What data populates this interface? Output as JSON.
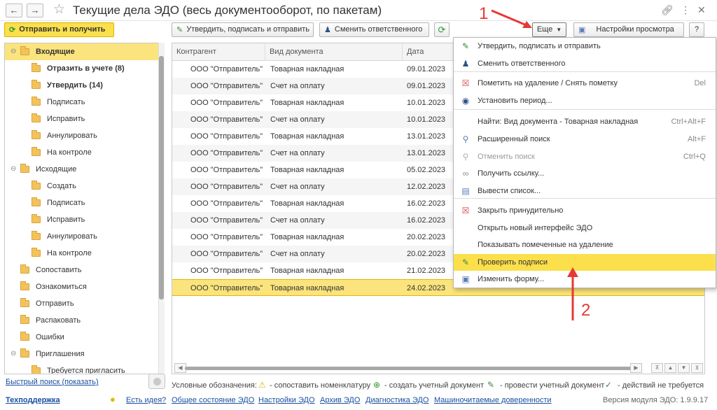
{
  "window": {
    "title": "Текущие дела ЭДО (весь документооборот, по пакетам)",
    "back_icon": "arrow-left-icon",
    "forward_icon": "arrow-right-icon",
    "favorite_icon": "star-icon",
    "link_icon": "link-icon",
    "more_icon": "more-vertical-icon",
    "close_icon": "close-icon"
  },
  "toolbar": {
    "send_receive_label": "Отправить и получить",
    "approve_label": "Утвердить, подписать и отправить",
    "change_responsible_label": "Сменить ответственного",
    "more_label": "Еще",
    "view_settings_label": "Настройки просмотра",
    "help_label": "?"
  },
  "tree": {
    "items": [
      {
        "label": "Входящие",
        "toggle": "⊖",
        "bold": true
      },
      {
        "label": "Отразить в учете (8)",
        "bold": true
      },
      {
        "label": "Утвердить (14)",
        "bold": true
      },
      {
        "label": "Подписать"
      },
      {
        "label": "Исправить"
      },
      {
        "label": "Аннулировать"
      },
      {
        "label": "На контроле"
      },
      {
        "label": "Исходящие",
        "toggle": "⊖"
      },
      {
        "label": "Создать"
      },
      {
        "label": "Подписать"
      },
      {
        "label": "Исправить"
      },
      {
        "label": "Аннулировать"
      },
      {
        "label": "На контроле"
      },
      {
        "label": "Сопоставить"
      },
      {
        "label": "Ознакомиться"
      },
      {
        "label": "Отправить"
      },
      {
        "label": "Распаковать"
      },
      {
        "label": "Ошибки"
      },
      {
        "label": "Приглашения",
        "toggle": "⊖"
      },
      {
        "label": "Требуется пригласить"
      }
    ]
  },
  "table": {
    "columns": [
      "Контрагент",
      "Вид документа",
      "Дата"
    ],
    "rows": [
      {
        "counterparty": "ООО \"Отправитель\"",
        "doc_type": "Товарная накладная",
        "date": "09.01.2023"
      },
      {
        "counterparty": "ООО \"Отправитель\"",
        "doc_type": "Счет на оплату",
        "date": "09.01.2023"
      },
      {
        "counterparty": "ООО \"Отправитель\"",
        "doc_type": "Товарная накладная",
        "date": "10.01.2023"
      },
      {
        "counterparty": "ООО \"Отправитель\"",
        "doc_type": "Счет на оплату",
        "date": "10.01.2023"
      },
      {
        "counterparty": "ООО \"Отправитель\"",
        "doc_type": "Товарная накладная",
        "date": "13.01.2023"
      },
      {
        "counterparty": "ООО \"Отправитель\"",
        "doc_type": "Счет на оплату",
        "date": "13.01.2023"
      },
      {
        "counterparty": "ООО \"Отправитель\"",
        "doc_type": "Товарная накладная",
        "date": "05.02.2023"
      },
      {
        "counterparty": "ООО \"Отправитель\"",
        "doc_type": "Счет на оплату",
        "date": "12.02.2023"
      },
      {
        "counterparty": "ООО \"Отправитель\"",
        "doc_type": "Товарная накладная",
        "date": "16.02.2023"
      },
      {
        "counterparty": "ООО \"Отправитель\"",
        "doc_type": "Счет на оплату",
        "date": "16.02.2023"
      },
      {
        "counterparty": "ООО \"Отправитель\"",
        "doc_type": "Товарная накладная",
        "date": "20.02.2023"
      },
      {
        "counterparty": "ООО \"Отправитель\"",
        "doc_type": "Счет на оплату",
        "date": "20.02.2023"
      },
      {
        "counterparty": "ООО \"Отправитель\"",
        "doc_type": "Товарная накладная",
        "date": "21.02.2023"
      },
      {
        "counterparty": "ООО \"Отправитель\"",
        "doc_type": "Товарная накладная",
        "date": "24.02.2023"
      }
    ]
  },
  "menu": {
    "items": [
      {
        "label": "Утвердить, подписать и отправить",
        "icon": "approve-icon",
        "shortcut": ""
      },
      {
        "label": "Сменить ответственного",
        "icon": "users-icon",
        "shortcut": ""
      },
      {
        "label": "Пометить на удаление / Снять пометку",
        "icon": "delete-mark-icon",
        "shortcut": "Del"
      },
      {
        "label": "Установить период...",
        "icon": "period-icon",
        "shortcut": ""
      },
      {
        "label": "Найти: Вид документа - Товарная накладная",
        "icon": "",
        "shortcut": "Ctrl+Alt+F"
      },
      {
        "label": "Расширенный поиск",
        "icon": "search-icon",
        "shortcut": "Alt+F"
      },
      {
        "label": "Отменить поиск",
        "icon": "cancel-search-icon",
        "shortcut": "Ctrl+Q"
      },
      {
        "label": "Получить ссылку...",
        "icon": "link-icon",
        "shortcut": ""
      },
      {
        "label": "Вывести список...",
        "icon": "list-icon",
        "shortcut": ""
      },
      {
        "label": "Закрыть принудительно",
        "icon": "force-close-icon",
        "shortcut": ""
      },
      {
        "label": "Открыть новый интерфейс ЭДО",
        "icon": "",
        "shortcut": ""
      },
      {
        "label": "Показывать помеченные на удаление",
        "icon": "",
        "shortcut": ""
      },
      {
        "label": "Проверить подписи",
        "icon": "check-signature-icon",
        "shortcut": ""
      },
      {
        "label": "Изменить форму...",
        "icon": "form-icon",
        "shortcut": ""
      }
    ]
  },
  "annotations": {
    "marker_1": "1",
    "marker_2": "2"
  },
  "footer": {
    "quick_search": "Быстрый поиск (показать)",
    "legend_title": "Условные обозначения:",
    "legend_match": "- сопоставить номенклатуру",
    "legend_create": "- создать учетный документ",
    "legend_post": "- провести учетный документ",
    "legend_none": "- действий не требуется",
    "support": "Техподдержка",
    "idea": "Есть идея?",
    "edo_status": "Общее состояние ЭДО",
    "edo_settings": "Настройки ЭДО",
    "edo_archive": "Архив ЭДО",
    "edo_diagnostics": "Диагностика ЭДО",
    "machine_poa": "Машиночитаемые доверенности",
    "module_version": "Версия модуля ЭДО: 1.9.9.17"
  },
  "colors": {
    "accent_yellow": "#fbe04c",
    "selection": "#fbe47d",
    "annotation_red": "#e53935",
    "link_blue": "#1a4fa0"
  }
}
